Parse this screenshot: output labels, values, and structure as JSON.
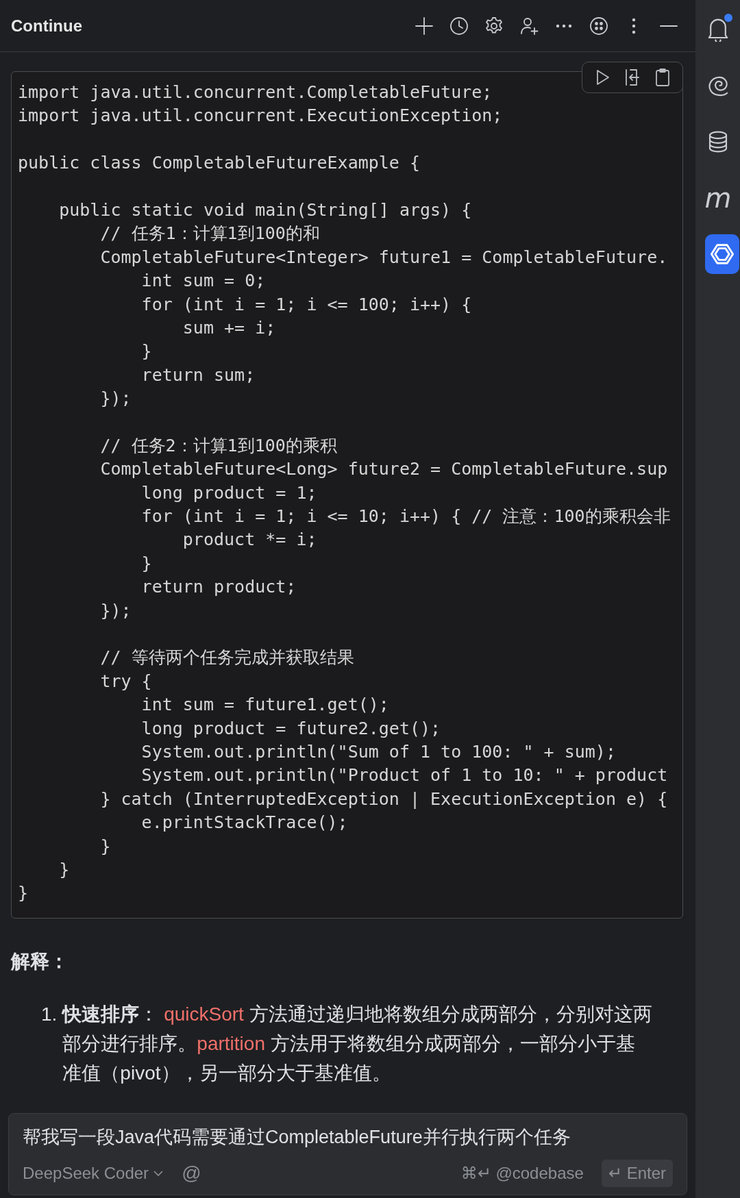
{
  "header": {
    "title": "Continue",
    "actions": [
      {
        "kind": "plus"
      },
      {
        "kind": "history"
      },
      {
        "kind": "settings"
      },
      {
        "kind": "add-user"
      },
      {
        "kind": "more"
      },
      {
        "kind": "dots-circle"
      },
      {
        "kind": "kebab"
      },
      {
        "kind": "minimize"
      }
    ]
  },
  "sidebar": {
    "items": [
      {
        "kind": "bell",
        "badge": true,
        "selected": false
      },
      {
        "kind": "spiral",
        "selected": false
      },
      {
        "kind": "database",
        "selected": false
      },
      {
        "kind": "letter",
        "text": "m",
        "selected": false
      },
      {
        "kind": "hexagon",
        "selected": true
      }
    ]
  },
  "code_block": {
    "toolbar": [
      {
        "kind": "run"
      },
      {
        "kind": "insert"
      },
      {
        "kind": "copy"
      }
    ],
    "lines": [
      {
        "kind": "code",
        "text": "import java.util.concurrent.CompletableFuture;"
      },
      {
        "kind": "code",
        "text": "import java.util.concurrent.ExecutionException;"
      },
      {
        "kind": "blank"
      },
      {
        "kind": "code",
        "text": "public class CompletableFutureExample {"
      },
      {
        "kind": "blank"
      },
      {
        "kind": "code",
        "text": "    public static void main(String[] args) {"
      },
      {
        "kind": "code",
        "text": "        // 任务1：计算1到100的和"
      },
      {
        "kind": "code",
        "text": "        CompletableFuture<Integer> future1 = CompletableFuture."
      },
      {
        "kind": "code",
        "text": "            int sum = 0;"
      },
      {
        "kind": "code",
        "text": "            for (int i = 1; i <= 100; i++) {"
      },
      {
        "kind": "code",
        "text": "                sum += i;"
      },
      {
        "kind": "code",
        "text": "            }"
      },
      {
        "kind": "code",
        "text": "            return sum;"
      },
      {
        "kind": "code",
        "text": "        });"
      },
      {
        "kind": "blank"
      },
      {
        "kind": "code",
        "text": "        // 任务2：计算1到100的乘积"
      },
      {
        "kind": "code",
        "text": "        CompletableFuture<Long> future2 = CompletableFuture.sup"
      },
      {
        "kind": "code",
        "text": "            long product = 1;"
      },
      {
        "kind": "code",
        "text": "            for (int i = 1; i <= 10; i++) { // 注意：100的乘积会非"
      },
      {
        "kind": "code",
        "text": "                product *= i;"
      },
      {
        "kind": "code",
        "text": "            }"
      },
      {
        "kind": "code",
        "text": "            return product;"
      },
      {
        "kind": "code",
        "text": "        });"
      },
      {
        "kind": "blank"
      },
      {
        "kind": "code",
        "text": "        // 等待两个任务完成并获取结果"
      },
      {
        "kind": "code",
        "text": "        try {"
      },
      {
        "kind": "code",
        "text": "            int sum = future1.get();"
      },
      {
        "kind": "code",
        "text": "            long product = future2.get();"
      },
      {
        "kind": "code",
        "text": "            System.out.println(\"Sum of 1 to 100: \" + sum);"
      },
      {
        "kind": "code",
        "text": "            System.out.println(\"Product of 1 to 10: \" + product"
      },
      {
        "kind": "code",
        "text": "        } catch (InterruptedException | ExecutionException e) {"
      },
      {
        "kind": "code",
        "text": "            e.printStackTrace();"
      },
      {
        "kind": "code",
        "text": "        }"
      },
      {
        "kind": "code",
        "text": "    }"
      },
      {
        "kind": "code",
        "text": "}"
      }
    ]
  },
  "explanation": {
    "heading": "解释：",
    "items": [
      {
        "number": "1.",
        "parts": [
          {
            "kind": "bold",
            "text": "快速排序"
          },
          {
            "kind": "text",
            "text": "： "
          },
          {
            "kind": "code",
            "text": "quickSort"
          },
          {
            "kind": "text",
            "text": " 方法通过递归地将数组分成两部分，分别对这两部分进行排序。"
          },
          {
            "kind": "code",
            "text": "partition"
          },
          {
            "kind": "text",
            "text": " 方法用于将数组分成两部分，一部分小于基准值（pivot），另一部分大于基准值。"
          }
        ]
      }
    ]
  },
  "input": {
    "value": "帮我写一段Java代码需要通过CompletableFuture并行执行两个任务",
    "model": "DeepSeek Coder",
    "mention": "@",
    "codebase_hint": "⌘↵ @codebase",
    "submit": "↵ Enter"
  }
}
